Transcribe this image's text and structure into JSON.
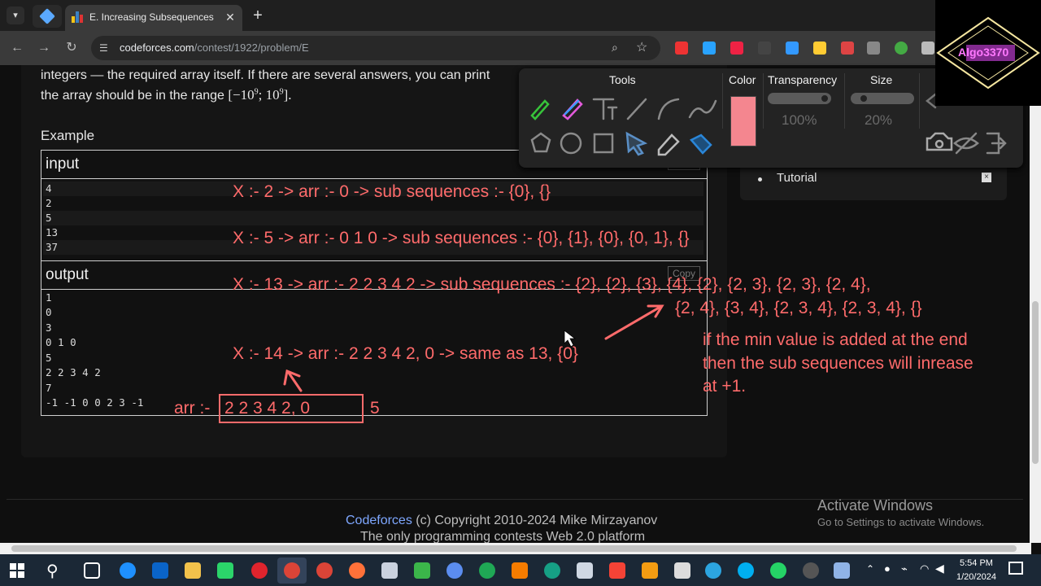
{
  "browser": {
    "tab_title": "E. Increasing Subsequences",
    "url_domain": "codeforces.com",
    "url_path": "/contest/1922/problem/E"
  },
  "problem": {
    "text_line1": "integers — the required array itself. If there are several answers, you can print",
    "text_line2_prefix": "the array should be in the range [−10",
    "text_line2_mid": "; 10",
    "text_line2_suffix": "].",
    "exponent": "9",
    "example_label": "Example",
    "input_label": "input",
    "output_label": "output",
    "copy_label": "Copy",
    "input_lines": [
      "4",
      "2",
      "5",
      "13",
      "37"
    ],
    "output_lines": [
      "1",
      "0",
      "3",
      "0 1 0",
      "5",
      "2 2 3 4 2",
      "7",
      "-1 -1 0 0 2 3 -1"
    ]
  },
  "sidebar": {
    "item_label": "Tutorial",
    "close_label": "×"
  },
  "draw_toolbar": {
    "tools_label": "Tools",
    "color_label": "Color",
    "transparency_label": "Transparency",
    "transparency_value": "100%",
    "size_label": "Size",
    "size_value": "20%",
    "selected_color": "#f4868f"
  },
  "logo_text": "Algo3370",
  "annotations": {
    "line1": "X :- 2  ->  arr :- 0  -> sub sequences :- {0}, {}",
    "line2": "X :- 5  -> arr :- 0  1   0  -> sub sequences :- {0}, {1}, {0}, {0, 1}, {}",
    "line3": "X :- 13 -> arr :- 2  2  3  4  2 -> sub sequences :- {2}, {2}, {3}, {4}, {2}, {2, 3}, {2, 3}, {2, 4},",
    "line3b": "{2, 4}, {3, 4}, {2, 3, 4}, {2, 3, 4}, {}",
    "line4": "X :- 14 -> arr :- 2  2  3   4  2, 0 -> same as 13, {0}",
    "note1": "if the min value is added at the end",
    "note2": "then the sub sequences will inrease",
    "note3": "at +1.",
    "arr_prefix": "arr :-",
    "arr_boxed": "2  2  3  4   2, 0",
    "arr_suffix": "5",
    "color": "#ff6b6b"
  },
  "footer": {
    "brand": "Codeforces",
    "copyright": " (c) Copyright 2010-2024 Mike Mirzayanov",
    "tagline": "The only programming contests Web 2.0 platform"
  },
  "watermark": {
    "title": "Activate Windows",
    "subtitle": "Go to Settings to activate Windows."
  },
  "taskbar": {
    "time": "5:54 PM",
    "date": "1/20/2024"
  }
}
